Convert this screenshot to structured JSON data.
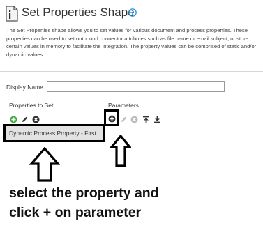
{
  "header": {
    "title": "Set Properties Shape",
    "description": "The Set Properties shape allows you to set values for various document and process properties. These properties can be used to set outbound connector attributes such as file name or email subject, or store certain values in memory to facilitate the integration. The property values can be comprised of static and/or dynamic values."
  },
  "form": {
    "display_name_label": "Display Name",
    "display_name_value": ""
  },
  "properties_panel": {
    "label": "Properties to Set",
    "items": [
      "Dynamic Process Property - First"
    ]
  },
  "parameters_panel": {
    "label": "Parameters"
  },
  "annotation": {
    "line1": "select the property and",
    "line2": "click + on parameter"
  },
  "colors": {
    "accent_blue": "#1b8fd6",
    "add_green": "#3aa83a",
    "selection_gray": "#e2e2e2"
  },
  "icons": {
    "shape_icon": "document-icon",
    "info_icon": "info-icon",
    "add_property": "add-icon",
    "edit_property": "pencil-icon",
    "remove_property": "remove-icon",
    "add_parameter": "add-icon",
    "edit_parameter": "pencil-icon",
    "remove_parameter": "remove-icon",
    "move_top": "move-top-icon",
    "move_bottom": "move-bottom-icon"
  }
}
